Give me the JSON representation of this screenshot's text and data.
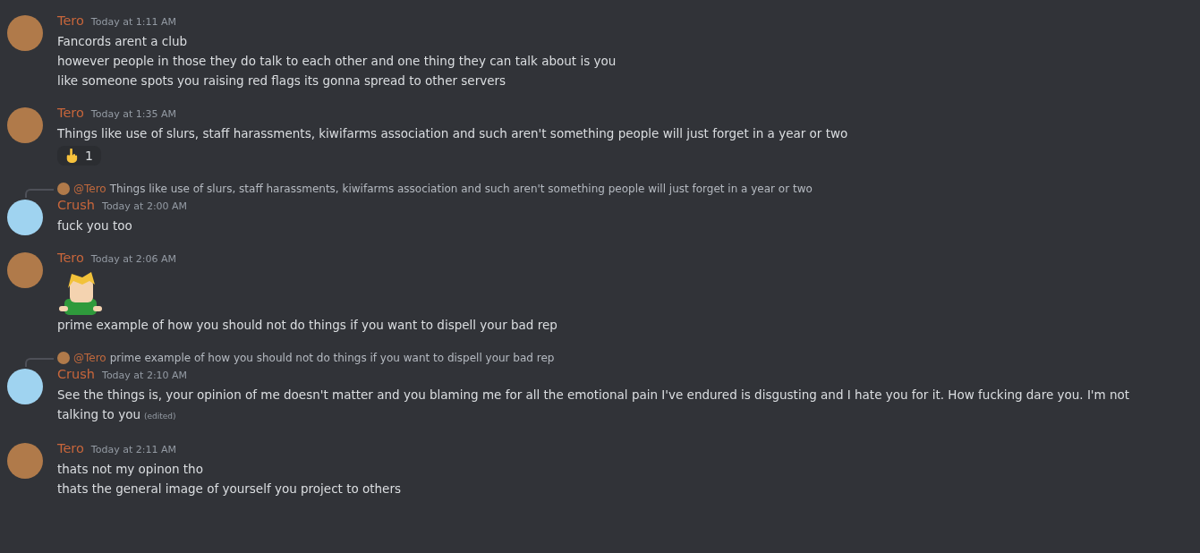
{
  "messages": [
    {
      "author": "Tero",
      "color": "#b07a4a",
      "time": "Today at 1:11 AM",
      "lines": [
        "Fancords arent a club",
        "however people in those they do talk to each other and one thing they can talk about is you",
        "like someone spots you raising red flags its gonna spread to other servers"
      ]
    },
    {
      "author": "Tero",
      "color": "#b07a4a",
      "time": "Today at 1:35 AM",
      "lines": [
        "Things like use of slurs, staff harassments, kiwifarms association and such aren't something people will just forget in a year or two"
      ],
      "reaction": {
        "count": "1"
      }
    },
    {
      "author": "Crush",
      "color": "#9fd3f0",
      "time": "Today at 2:00 AM",
      "reply": {
        "author": "@Tero",
        "color": "#b07a4a",
        "text": "Things like use of slurs, staff harassments, kiwifarms association and such aren't something people will just forget in a year or two"
      },
      "lines": [
        "fuck you too"
      ]
    },
    {
      "author": "Tero",
      "color": "#b07a4a",
      "time": "Today at 2:06 AM",
      "sticker": true,
      "lines": [
        "prime example of how you should not do things if you want to dispell your bad rep"
      ]
    },
    {
      "author": "Crush",
      "color": "#9fd3f0",
      "time": "Today at 2:10 AM",
      "reply": {
        "author": "@Tero",
        "color": "#b07a4a",
        "text": "prime example of how you should not do things if you want to dispell your bad rep"
      },
      "lines": [
        "See the things is, your opinion of me doesn't matter and you blaming me for all the emotional pain I've endured is disgusting and I hate you for it. How fucking dare you. I'm not talking to you"
      ],
      "edited": "(edited)"
    },
    {
      "author": "Tero",
      "color": "#b07a4a",
      "time": "Today at 2:11 AM",
      "lines": [
        "thats not my opinon tho",
        "thats the general image of yourself you project to others"
      ]
    }
  ]
}
